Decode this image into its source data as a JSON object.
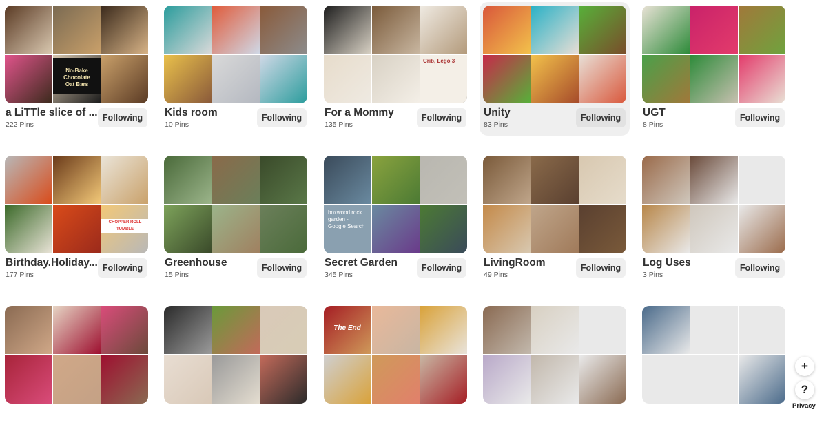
{
  "boards": [
    {
      "title": "a LiTTle slice of ...",
      "pins": "222 Pins",
      "button": "Following",
      "colors": [
        "#5a3a24",
        "#e0548b",
        "#7a6a52",
        "#d9c8b0",
        "#3b2a1c",
        "#c9a06a",
        "#1b1b1b",
        "#d8b487"
      ],
      "overlay_text": [
        "No-Bake",
        "Chocolate",
        "Oat Bars"
      ]
    },
    {
      "title": "Kids room",
      "pins": "10 Pins",
      "button": "Following",
      "colors": [
        "#2a9c9c",
        "#e9c04b",
        "#e05b3b",
        "#d9d9d9",
        "#8a5a3a",
        "#cfd8e6",
        "#b4b8c0",
        "#8c8c8c"
      ]
    },
    {
      "title": "For a Mommy",
      "pins": "135 Pins",
      "button": "Following",
      "colors": [
        "#1d1d1d",
        "#e7dccb",
        "#7a5a3a",
        "#d8d1c4",
        "#efeae2",
        "#c8b6a0",
        "#f4efe7",
        "#b39a7b"
      ],
      "overlay_text": [
        "Crib, Lego 3"
      ]
    },
    {
      "title": "Unity",
      "pins": "83 Pins",
      "button": "Following",
      "colors": [
        "#d9573b",
        "#c62a4a",
        "#2ab1c6",
        "#f2c14b",
        "#57b03a",
        "#e8ded5",
        "#a64b2a",
        "#7a4c2a"
      ]
    },
    {
      "title": "UGT",
      "pins": "8 Pins",
      "button": "Following",
      "colors": [
        "#e9e2d6",
        "#4aa04a",
        "#c9226a",
        "#2e8b3a",
        "#a1783a",
        "#e33b6b",
        "#c7c0b0",
        "#6fa33e"
      ]
    },
    {
      "title": "Birthday.Holiday...",
      "pins": "177 Pins",
      "button": "Following",
      "colors": [
        "#b8b8b8",
        "#3c6a2a",
        "#6a3a1a",
        "#d94b1a",
        "#eae4d8",
        "#f2c878",
        "#9b2a1b",
        "#c9a16a"
      ],
      "overlay_text": [
        "CHOPPER ROLL TUMBLE"
      ]
    },
    {
      "title": "Greenhouse",
      "pins": "15 Pins",
      "button": "Following",
      "colors": [
        "#4a6a3a",
        "#7da25a",
        "#8a6a4a",
        "#9bb48a",
        "#3a4a2a",
        "#6b7f5a",
        "#a08060",
        "#5a7848"
      ]
    },
    {
      "title": "Secret Garden",
      "pins": "345 Pins",
      "button": "Following",
      "colors": [
        "#3a4a5a",
        "#4a7a9a",
        "#8aa33e",
        "#6a8aa0",
        "#b9b7b0",
        "#4c7a34",
        "#6a3a8a",
        "#c2c0b8"
      ],
      "overlay_text": [
        "boxwood rock garden - Google Search"
      ]
    },
    {
      "title": "LivingRoom",
      "pins": "49 Pins",
      "button": "Following",
      "colors": [
        "#7a5a3a",
        "#c48a4a",
        "#8a6a4a",
        "#bfa58a",
        "#d8c8b0",
        "#5a4030",
        "#a07a5a",
        "#e6dccb"
      ]
    },
    {
      "title": "Log Uses",
      "pins": "3 Pins",
      "button": "Following",
      "colors": [
        "#9a6a4a",
        "#b8874a",
        "#6a4a3a",
        "#cfc7bc",
        "#e9e9e9",
        "#e9e9e9",
        "#e9e9e9",
        "#e9e9e9"
      ]
    },
    {
      "title": "",
      "pins": "",
      "button": "",
      "colors": [
        "#8a6a52",
        "#a8243a",
        "#e6d5c4",
        "#d0a888",
        "#d94c7a",
        "#9e1030",
        "#c4a185",
        "#6a4a3a"
      ]
    },
    {
      "title": "",
      "pins": "",
      "button": "",
      "colors": [
        "#2a2a2a",
        "#e8ddd2",
        "#6a9a3a",
        "#9a9a9a",
        "#d9c9b8",
        "#c26a5a",
        "#e4ddd0",
        "#d8cdb6"
      ]
    },
    {
      "title": "",
      "pins": "",
      "button": "",
      "colors": [
        "#a51d24",
        "#cfcfcf",
        "#e9b89a",
        "#cf9a5a",
        "#d9a23a",
        "#c8b6a3",
        "#e1806b",
        "#e9e4dc"
      ],
      "overlay_text": [
        "The End"
      ]
    },
    {
      "title": "",
      "pins": "",
      "button": "",
      "colors": [
        "#8a6a52",
        "#b9a9c9",
        "#d8d0c2",
        "#c2b8ac",
        "#e9e9e9",
        "#e9e9e9",
        "#e9e9e9",
        "#e9e9e9"
      ]
    },
    {
      "title": "",
      "pins": "",
      "button": "",
      "colors": [
        "#4a6a8a",
        "#e9e9e9",
        "#e9e9e9",
        "#e9e9e9",
        "#e9e9e9",
        "#e9e9e9",
        "#e9e9e9",
        "#e9e9e9"
      ]
    }
  ],
  "side": {
    "plus": "+",
    "help": "?",
    "privacy": "Privacy"
  }
}
